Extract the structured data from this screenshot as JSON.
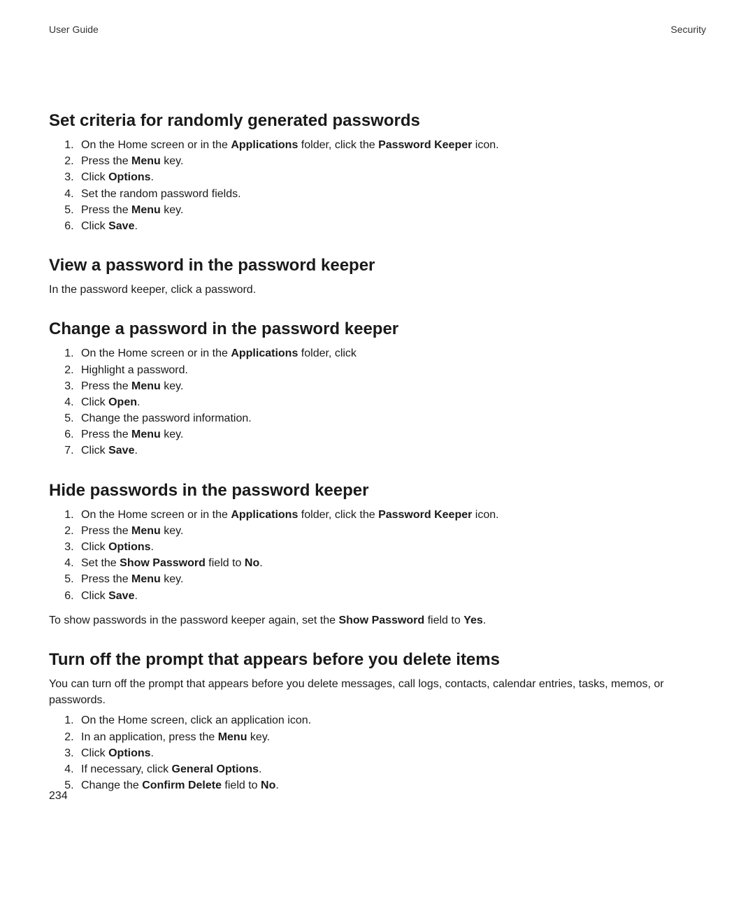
{
  "header": {
    "left": "User Guide",
    "right": "Security"
  },
  "sections": [
    {
      "title": "Set criteria for randomly generated passwords",
      "intro": null,
      "steps": [
        [
          {
            "t": "On the Home screen or in the "
          },
          {
            "t": "Applications",
            "b": true
          },
          {
            "t": " folder, click the "
          },
          {
            "t": "Password Keeper",
            "b": true
          },
          {
            "t": " icon."
          }
        ],
        [
          {
            "t": "Press the "
          },
          {
            "t": "Menu",
            "b": true
          },
          {
            "t": " key."
          }
        ],
        [
          {
            "t": "Click "
          },
          {
            "t": "Options",
            "b": true
          },
          {
            "t": "."
          }
        ],
        [
          {
            "t": "Set the random password fields."
          }
        ],
        [
          {
            "t": "Press the "
          },
          {
            "t": "Menu",
            "b": true
          },
          {
            "t": " key."
          }
        ],
        [
          {
            "t": "Click "
          },
          {
            "t": "Save",
            "b": true
          },
          {
            "t": "."
          }
        ]
      ],
      "outro": null
    },
    {
      "title": "View a password in the password keeper",
      "intro": [
        {
          "t": "In the password keeper, click a password."
        }
      ],
      "steps": null,
      "outro": null
    },
    {
      "title": "Change a password in the password keeper",
      "intro": null,
      "steps": [
        [
          {
            "t": "On the Home screen or in the "
          },
          {
            "t": "Applications",
            "b": true
          },
          {
            "t": " folder, click"
          }
        ],
        [
          {
            "t": "Highlight a password."
          }
        ],
        [
          {
            "t": "Press the "
          },
          {
            "t": "Menu",
            "b": true
          },
          {
            "t": " key."
          }
        ],
        [
          {
            "t": "Click "
          },
          {
            "t": "Open",
            "b": true
          },
          {
            "t": "."
          }
        ],
        [
          {
            "t": "Change the password information."
          }
        ],
        [
          {
            "t": "Press the "
          },
          {
            "t": "Menu",
            "b": true
          },
          {
            "t": " key."
          }
        ],
        [
          {
            "t": "Click "
          },
          {
            "t": "Save",
            "b": true
          },
          {
            "t": "."
          }
        ]
      ],
      "outro": null
    },
    {
      "title": "Hide passwords in the password keeper",
      "intro": null,
      "steps": [
        [
          {
            "t": "On the Home screen or in the "
          },
          {
            "t": "Applications",
            "b": true
          },
          {
            "t": " folder, click the "
          },
          {
            "t": "Password Keeper",
            "b": true
          },
          {
            "t": " icon."
          }
        ],
        [
          {
            "t": "Press the "
          },
          {
            "t": "Menu",
            "b": true
          },
          {
            "t": " key."
          }
        ],
        [
          {
            "t": "Click "
          },
          {
            "t": "Options",
            "b": true
          },
          {
            "t": "."
          }
        ],
        [
          {
            "t": "Set the "
          },
          {
            "t": "Show Password",
            "b": true
          },
          {
            "t": " field to "
          },
          {
            "t": "No",
            "b": true
          },
          {
            "t": "."
          }
        ],
        [
          {
            "t": "Press the "
          },
          {
            "t": "Menu",
            "b": true
          },
          {
            "t": " key."
          }
        ],
        [
          {
            "t": "Click "
          },
          {
            "t": "Save",
            "b": true
          },
          {
            "t": "."
          }
        ]
      ],
      "outro": [
        {
          "t": "To show passwords in the password keeper again, set the "
        },
        {
          "t": "Show Password",
          "b": true
        },
        {
          "t": " field to "
        },
        {
          "t": "Yes",
          "b": true
        },
        {
          "t": "."
        }
      ]
    },
    {
      "title": "Turn off the prompt that appears before you delete items",
      "intro": [
        {
          "t": "You can turn off the prompt that appears before you delete messages, call logs, contacts, calendar entries, tasks, memos, or passwords."
        }
      ],
      "steps": [
        [
          {
            "t": "On the Home screen, click an application icon."
          }
        ],
        [
          {
            "t": "In an application, press the "
          },
          {
            "t": "Menu",
            "b": true
          },
          {
            "t": " key."
          }
        ],
        [
          {
            "t": "Click "
          },
          {
            "t": "Options",
            "b": true
          },
          {
            "t": "."
          }
        ],
        [
          {
            "t": "If necessary, click "
          },
          {
            "t": "General Options",
            "b": true
          },
          {
            "t": "."
          }
        ],
        [
          {
            "t": "Change the "
          },
          {
            "t": "Confirm Delete",
            "b": true
          },
          {
            "t": " field to "
          },
          {
            "t": "No",
            "b": true
          },
          {
            "t": "."
          }
        ]
      ],
      "outro": null
    }
  ],
  "page_number": "234"
}
